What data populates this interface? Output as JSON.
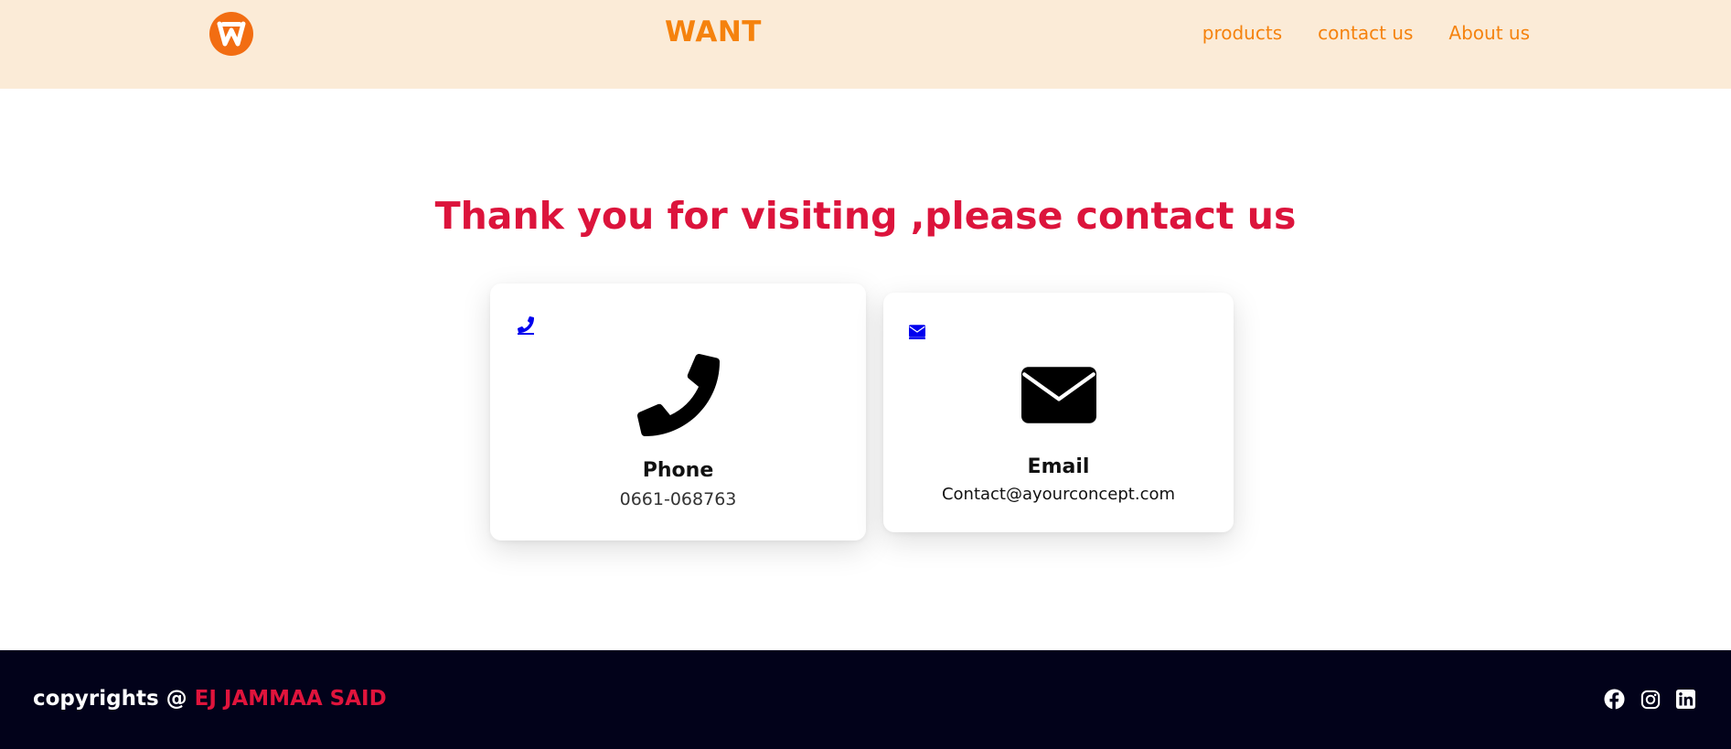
{
  "header": {
    "brand": "WANT",
    "logo_letter": "W",
    "nav": [
      {
        "label": "products"
      },
      {
        "label": "contact us"
      },
      {
        "label": "About us"
      }
    ]
  },
  "main": {
    "headline": "Thank you for visiting ,please contact us",
    "cards": [
      {
        "title": "Phone",
        "value": "0661-068763",
        "icon": "phone-icon"
      },
      {
        "title": "Email",
        "value": "Contact@ayourconcept.com",
        "icon": "envelope-icon"
      }
    ]
  },
  "footer": {
    "copyright_prefix": "copyrights @ ",
    "owner": "EJ JAMMAA SAID",
    "socials": [
      "facebook-icon",
      "instagram-icon",
      "linkedin-icon"
    ]
  },
  "colors": {
    "header_bg": "#fbebd7",
    "accent_orange": "#f5820d",
    "headline_red": "#dc143c",
    "footer_bg": "#02021a",
    "link_blue": "#0000ee"
  }
}
